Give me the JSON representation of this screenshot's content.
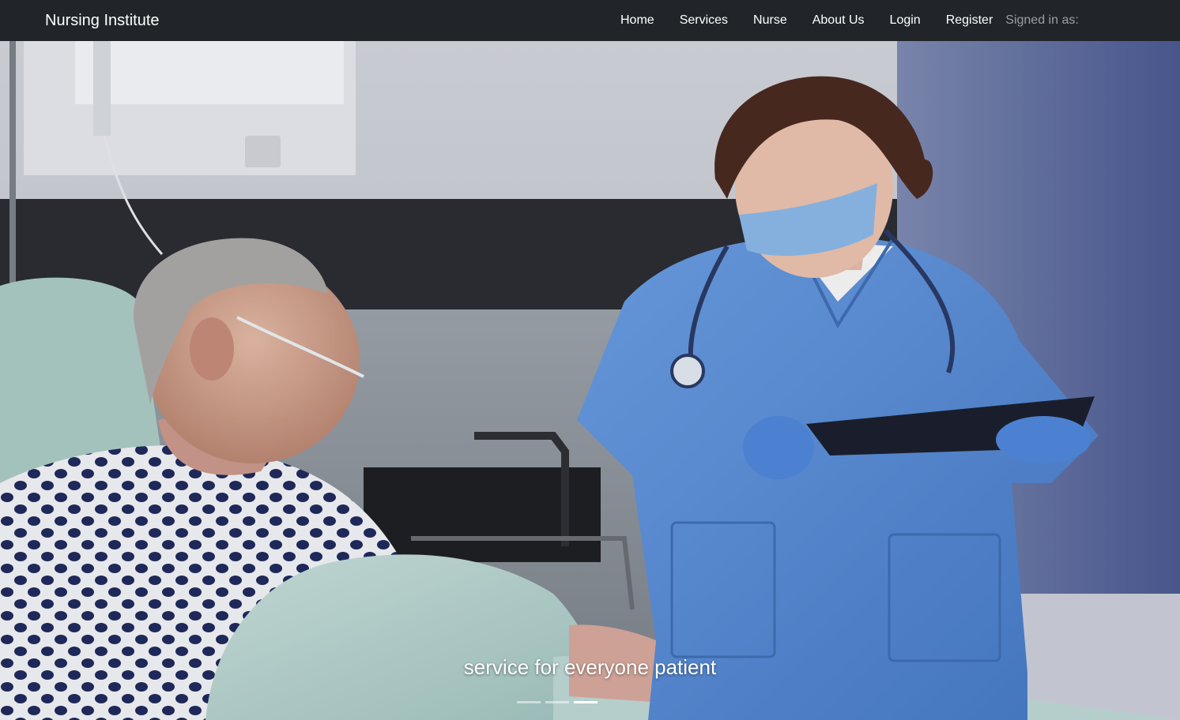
{
  "navbar": {
    "brand": "Nursing Institute",
    "links": [
      {
        "label": "Home"
      },
      {
        "label": "Services"
      },
      {
        "label": "Nurse"
      },
      {
        "label": "About Us"
      },
      {
        "label": "Login"
      },
      {
        "label": "Register"
      }
    ],
    "signed_in_label": "Signed in as:"
  },
  "carousel": {
    "caption": "service for everyone patient",
    "slide_count": 3,
    "active_slide": 3
  },
  "colors": {
    "navbar_bg": "#212529",
    "scrubs_blue": "#5b8fd6",
    "gown_navy": "#1f2a5c"
  }
}
